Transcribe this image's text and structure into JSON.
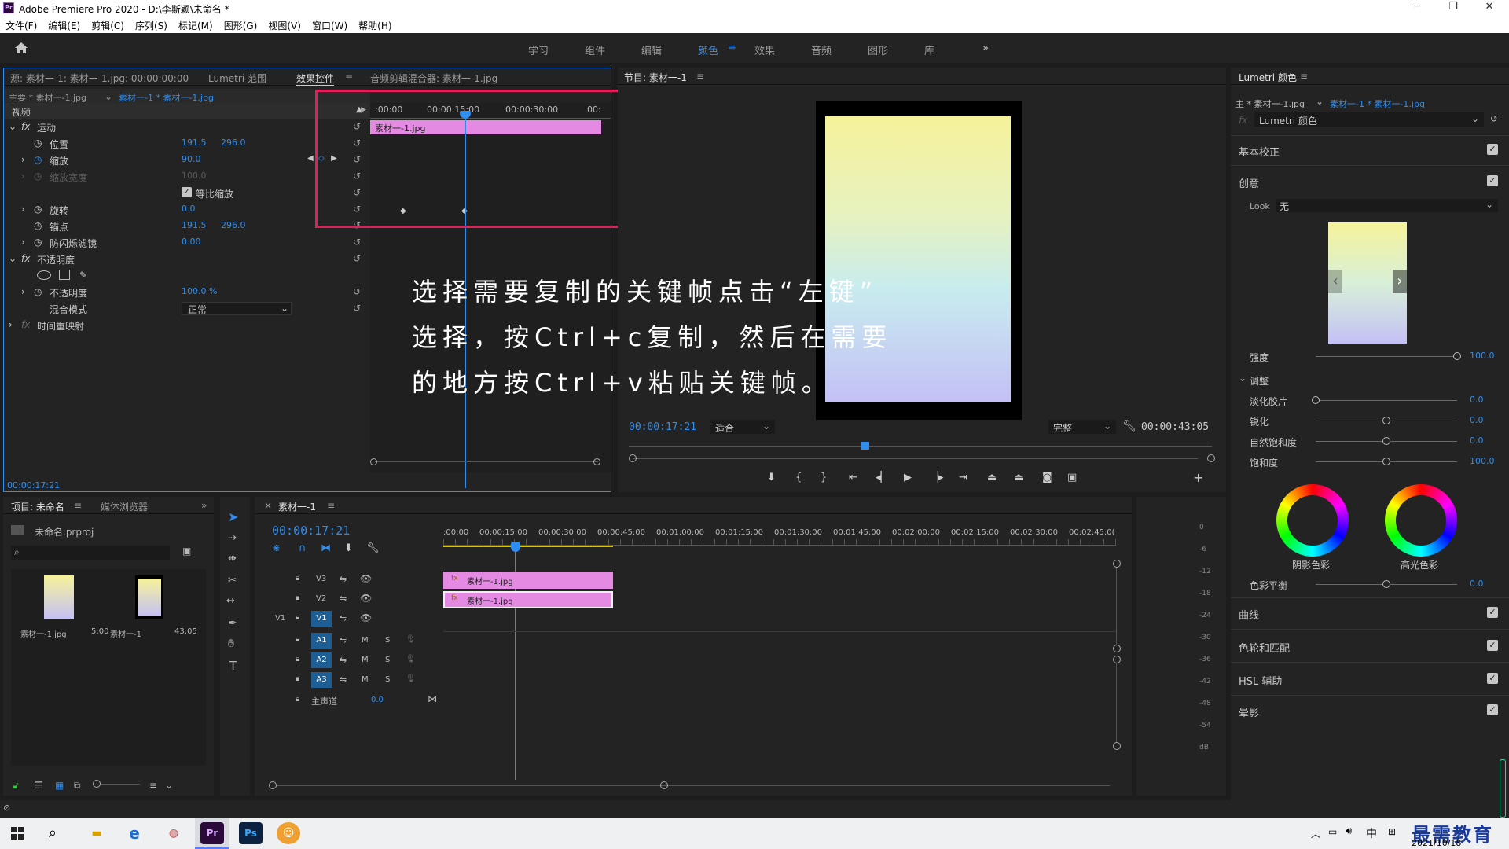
{
  "window": {
    "title": "Adobe Premiere Pro 2020 - D:\\李斯颖\\未命名 *",
    "menu": [
      "文件(F)",
      "编辑(E)",
      "剪辑(C)",
      "序列(S)",
      "标记(M)",
      "图形(G)",
      "视图(V)",
      "窗口(W)",
      "帮助(H)"
    ]
  },
  "workspaces": {
    "items": [
      "学习",
      "组件",
      "编辑",
      "颜色",
      "效果",
      "音频",
      "图形",
      "库"
    ],
    "active": "颜色",
    "more": "»"
  },
  "effects_panel": {
    "tabs": [
      "源: 素材一-1: 素材一-1.jpg: 00:00:00:00",
      "Lumetri 范围",
      "效果控件",
      "音频剪辑混合器: 素材一-1.jpg"
    ],
    "master": "主要 * 素材一-1.jpg",
    "clip": "素材一-1 * 素材一-1.jpg",
    "section_video": "视频",
    "motion": "运动",
    "position_label": "位置",
    "position_x": "191.5",
    "position_y": "296.0",
    "scale_label": "缩放",
    "scale_value": "90.0",
    "scale_width_label": "缩放宽度",
    "scale_width_value": "100.0",
    "uniform_scale": "等比缩放",
    "rotation_label": "旋转",
    "rotation_value": "0.0",
    "anchor_label": "锚点",
    "anchor_x": "191.5",
    "anchor_y": "296.0",
    "antiflicker_label": "防闪烁滤镜",
    "antiflicker_value": "0.00",
    "opacity_section": "不透明度",
    "opacity_label": "不透明度",
    "opacity_value": "100.0 %",
    "blend_label": "混合模式",
    "blend_value": "正常",
    "time_remap": "时间重映射",
    "timecode": "00:00:17:21",
    "ruler": [
      ":00:00",
      "00:00:15:00",
      "00:00:30:00",
      "00:"
    ],
    "clip_bar": "素材一-1.jpg"
  },
  "program": {
    "title": "节目: 素材一-1",
    "timecode": "00:00:17:21",
    "fit": "适合",
    "quality": "完整",
    "duration": "00:00:43:05"
  },
  "overlay": {
    "lines": [
      "选择需要复制的关键帧点击“左键”",
      "选择，按Ctrl+c复制，然后在需要",
      "的地方按Ctrl+v粘贴关键帧。"
    ]
  },
  "lumetri": {
    "title": "Lumetri 颜色",
    "master": "主 * 素材一-1.jpg",
    "clip": "素材一-1 * 素材一-1.jpg",
    "effect": "Lumetri 颜色",
    "basic": "基本校正",
    "creative": "创意",
    "look_label": "Look",
    "look_value": "无",
    "intensity_label": "强度",
    "intensity_value": "100.0",
    "adjust": "调整",
    "faded_label": "淡化胶片",
    "faded_value": "0.0",
    "sharpen_label": "锐化",
    "sharpen_value": "0.0",
    "vibrance_label": "自然饱和度",
    "vibrance_value": "0.0",
    "saturation_label": "饱和度",
    "saturation_value": "100.0",
    "shadow_tint": "阴影色彩",
    "highlight_tint": "高光色彩",
    "tint_balance_label": "色彩平衡",
    "tint_balance_value": "0.0",
    "curves": "曲线",
    "wheels": "色轮和匹配",
    "hsl": "HSL 辅助",
    "vignette": "晕影",
    "intensity_level": 1.0,
    "faded_level": 0.0,
    "sharpen_level": 0.5,
    "vibrance_level": 0.5,
    "saturation_level": 0.5,
    "tint_level": 0.5
  },
  "project": {
    "tabs": [
      "项目: 未命名",
      "媒体浏览器"
    ],
    "file": "未命名.prproj",
    "items": [
      {
        "name": "素材一-1.jpg",
        "duration": "5:00"
      },
      {
        "name": "素材一-1",
        "duration": "43:05"
      }
    ]
  },
  "timeline": {
    "tab": "素材一-1",
    "timecode": "00:00:17:21",
    "ruler": [
      ":00:00",
      "00:00:15:00",
      "00:00:30:00",
      "00:00:45:00",
      "00:01:00:00",
      "00:01:15:00",
      "00:01:30:00",
      "00:01:45:00",
      "00:02:00:00",
      "00:02:15:00",
      "00:02:30:00",
      "00:02:45:0("
    ],
    "video_tracks": [
      "V3",
      "V2",
      "V1"
    ],
    "audio_tracks": [
      "A1",
      "A2",
      "A3"
    ],
    "source_v": "V1",
    "master": "主声道",
    "master_value": "0.0",
    "clip_v3": "素材一-1.jpg",
    "clip_v2": "素材一-1.jpg",
    "mute": "M",
    "solo": "S"
  },
  "meters": {
    "scale": [
      "0",
      "-6",
      "-12",
      "-18",
      "-24",
      "-30",
      "-36",
      "-42",
      "-48",
      "-54",
      "dB"
    ]
  },
  "taskbar": {
    "tray": "中",
    "date": "2021/10/18",
    "watermark": "最需教育"
  },
  "colors": {
    "accent": "#2f8ded",
    "clip": "#e58ae3",
    "highlight": "#e0205b"
  }
}
